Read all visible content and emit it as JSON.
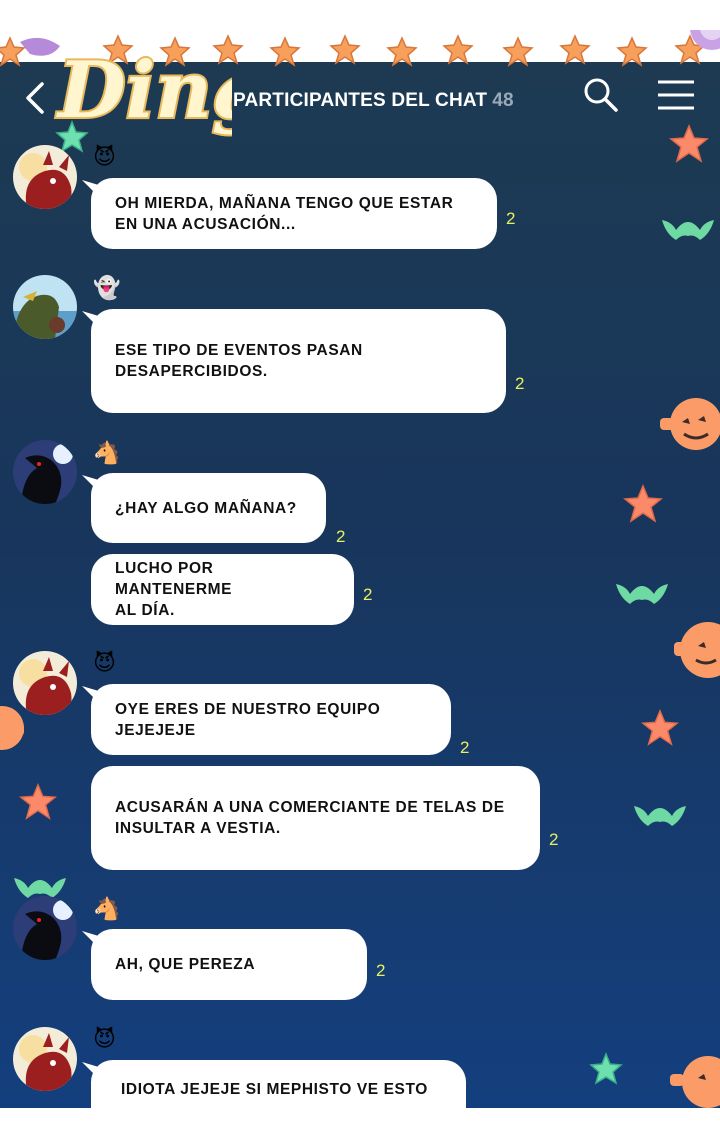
{
  "header": {
    "logo_text": "Ding",
    "title": "PARTICIPANTES DEL CHAT",
    "participant_count": "48"
  },
  "messages": [
    {
      "avatar": "red-devil-avatar",
      "emoji": "😈",
      "bubbles": [
        {
          "text": "OH MIERDA, MAÑANA TENGO QUE ESTAR\nEN UNA ACUSACIÓN...",
          "read": "2"
        }
      ]
    },
    {
      "avatar": "beach-character-avatar",
      "emoji": "👻",
      "bubbles": [
        {
          "text": "ESE TIPO DE EVENTOS PASAN DESAPERCIBIDOS.",
          "read": "2"
        }
      ]
    },
    {
      "avatar": "black-horse-avatar",
      "emoji": "🐴",
      "bubbles": [
        {
          "text": "¿HAY ALGO MAÑANA?",
          "read": "2"
        },
        {
          "text": "LUCHO POR MANTENERME\nAL DÍA.",
          "read": "2"
        }
      ]
    },
    {
      "avatar": "red-devil-avatar",
      "emoji": "😈",
      "bubbles": [
        {
          "text": "OYE ERES DE NUESTRO EQUIPO JEJEJEJE",
          "read": "2"
        },
        {
          "text": "ACUSARÁN A UNA COMERCIANTE DE TELAS DE\nINSULTAR A VESTIA.",
          "read": "2"
        }
      ]
    },
    {
      "avatar": "black-horse-avatar",
      "emoji": "🐴",
      "bubbles": [
        {
          "text": "AH, QUE PEREZA",
          "read": "2"
        }
      ]
    },
    {
      "avatar": "red-devil-avatar",
      "emoji": "😈",
      "bubbles": [
        {
          "text": "IDIOTA JEJEJE SI MEPHISTO VE ESTO",
          "read": ""
        }
      ]
    }
  ]
}
